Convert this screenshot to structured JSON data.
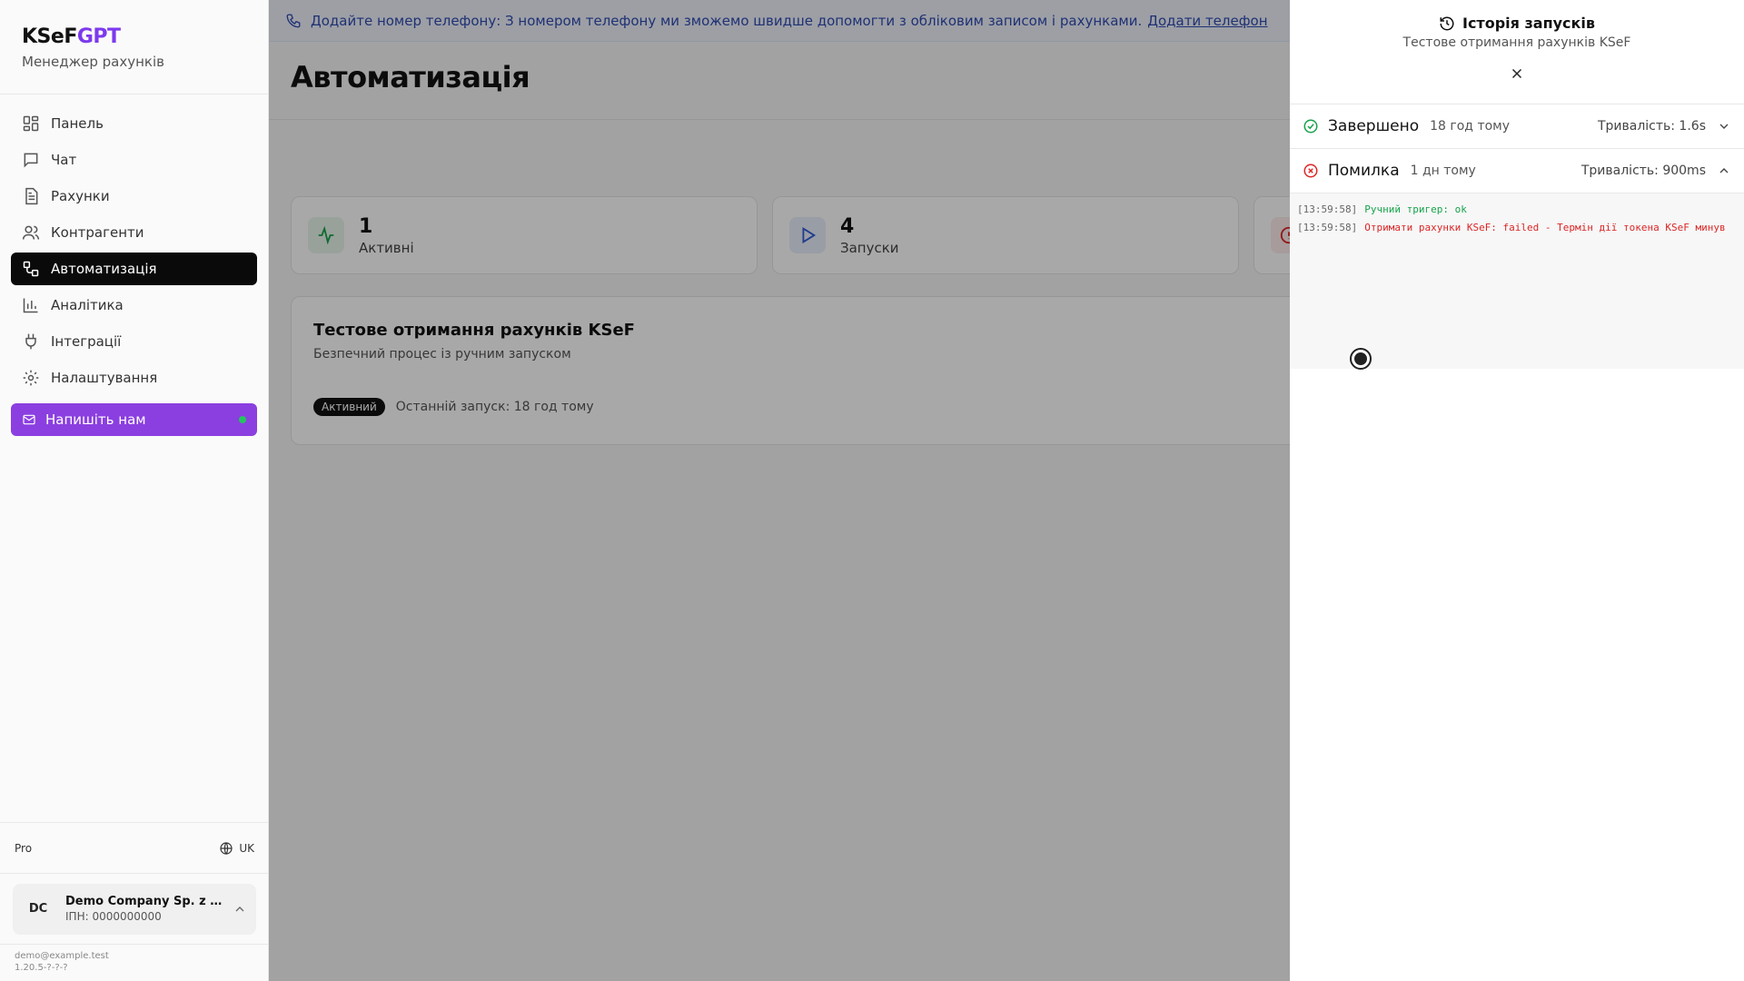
{
  "sidebar": {
    "brand_main": "KSeF",
    "brand_accent": "GPT",
    "brand_sub": "Менеджер рахунків",
    "items": [
      {
        "label": "Панель",
        "icon": "dashboard-icon"
      },
      {
        "label": "Чат",
        "icon": "chat-icon"
      },
      {
        "label": "Рахунки",
        "icon": "document-icon"
      },
      {
        "label": "Контрагенти",
        "icon": "users-icon"
      },
      {
        "label": "Автоматизація",
        "icon": "workflow-icon"
      },
      {
        "label": "Аналітика",
        "icon": "bar-chart-icon"
      },
      {
        "label": "Інтеграції",
        "icon": "plug-icon"
      },
      {
        "label": "Налаштування",
        "icon": "gear-icon"
      }
    ],
    "cta_label": "Напишіть нам",
    "plan": "Pro",
    "lang": "UK",
    "company_initials": "DC",
    "company_name": "Demo Company Sp. z o...",
    "company_tax": "ІПН: 0000000000",
    "email": "demo@example.test",
    "version": "1.20.5-?-?-?"
  },
  "banner": {
    "text": "Додайте номер телефону: З номером телефону ми зможемо швидше допомогти з обліковим записом і рахунками.",
    "link": "Додати телефон"
  },
  "page": {
    "title": "Автоматизація"
  },
  "stats": [
    {
      "value": "1",
      "label": "Активні"
    },
    {
      "value": "4",
      "label": "Запуски"
    }
  ],
  "workflow": {
    "title": "Тестове отримання рахунків KSeF",
    "subtitle": "Безпечний процес із ручним запуском",
    "badge": "Активний",
    "last_run": "Останній запуск: 18 год тому"
  },
  "drawer": {
    "title": "Історія запусків",
    "subtitle": "Тестове отримання рахунків KSeF",
    "runs": [
      {
        "status": "Завершено",
        "time": "18 год тому",
        "duration": "Тривалість: 1.6s"
      },
      {
        "status": "Помилка",
        "time": "1 дн тому",
        "duration": "Тривалість: 900ms"
      }
    ],
    "logs": [
      {
        "ts": "[13:59:58]",
        "msg": "Ручний тригер: ok"
      },
      {
        "ts": "[13:59:58]",
        "msg": "Отримати рахунки KSeF: failed - Термін дії токена KSeF минув"
      }
    ]
  },
  "colors": {
    "accent": "#8b3fe0",
    "success": "#16a34a",
    "error": "#dc2626",
    "banner_text": "#2f4bb0"
  }
}
